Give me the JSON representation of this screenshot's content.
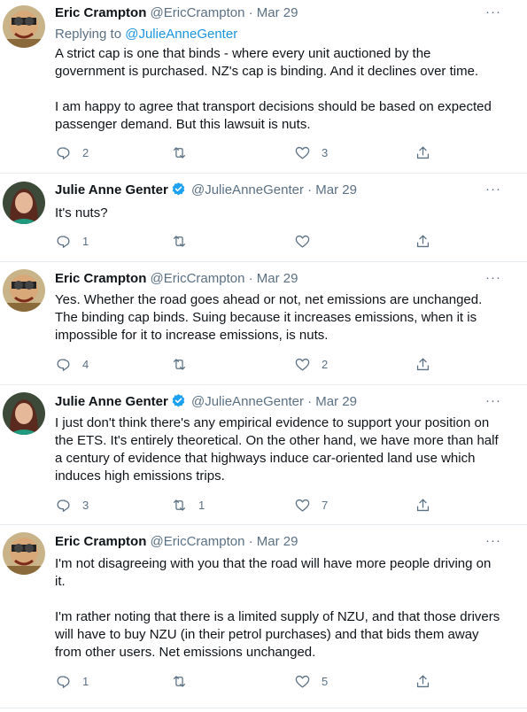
{
  "tweets": [
    {
      "author_name": "Eric Crampton",
      "handle": "@EricCrampton",
      "separator": "·",
      "date": "Mar 29",
      "verified": false,
      "replying_label": "Replying to ",
      "replying_handle": "@JulieAnneGenter",
      "paragraphs": [
        "A strict cap is one that binds - where every unit auctioned by the government is purchased. NZ's cap is binding. And it declines over time.",
        "I am happy to agree that transport decisions should be based on expected passenger demand. But this lawsuit is nuts."
      ],
      "replies": "2",
      "retweets": "",
      "likes": "3"
    },
    {
      "author_name": "Julie Anne Genter",
      "handle": "@JulieAnneGenter",
      "separator": "·",
      "date": "Mar 29",
      "verified": true,
      "paragraphs": [
        "It's nuts?"
      ],
      "replies": "1",
      "retweets": "",
      "likes": ""
    },
    {
      "author_name": "Eric Crampton",
      "handle": "@EricCrampton",
      "separator": "·",
      "date": "Mar 29",
      "verified": false,
      "paragraphs": [
        "Yes. Whether the road goes ahead or not, net emissions are unchanged. The binding cap binds. Suing because it increases emissions, when it is impossible for it to increase emissions, is nuts."
      ],
      "replies": "4",
      "retweets": "",
      "likes": "2"
    },
    {
      "author_name": "Julie Anne Genter",
      "handle": "@JulieAnneGenter",
      "separator": "·",
      "date": "Mar 29",
      "verified": true,
      "paragraphs": [
        "I just don't think there's any empirical evidence to support your position on the ETS. It's entirely theoretical. On the other hand, we have more than half a century of evidence that highways induce car-oriented land use which induces high emissions trips."
      ],
      "replies": "3",
      "retweets": "1",
      "likes": "7"
    },
    {
      "author_name": "Eric Crampton",
      "handle": "@EricCrampton",
      "separator": "·",
      "date": "Mar 29",
      "verified": false,
      "paragraphs": [
        "I'm not disagreeing with you that the road will have more people driving on it.",
        "I'm rather noting that there is a limited supply of NZU, and that those drivers will have to buy NZU (in their petrol purchases) and that bids them away from other users. Net emissions unchanged."
      ],
      "replies": "1",
      "retweets": "",
      "likes": "5"
    }
  ],
  "more_glyph": "···",
  "icons": {
    "reply": "reply-icon",
    "retweet": "retweet-icon",
    "like": "like-icon",
    "share": "share-icon",
    "more": "more-icon",
    "verified": "verified-badge-icon"
  },
  "colors": {
    "text": "#0f1419",
    "muted": "#5b7083",
    "link": "#1b95e0",
    "verified": "#1da1f2",
    "divider": "#e6ecf0"
  }
}
